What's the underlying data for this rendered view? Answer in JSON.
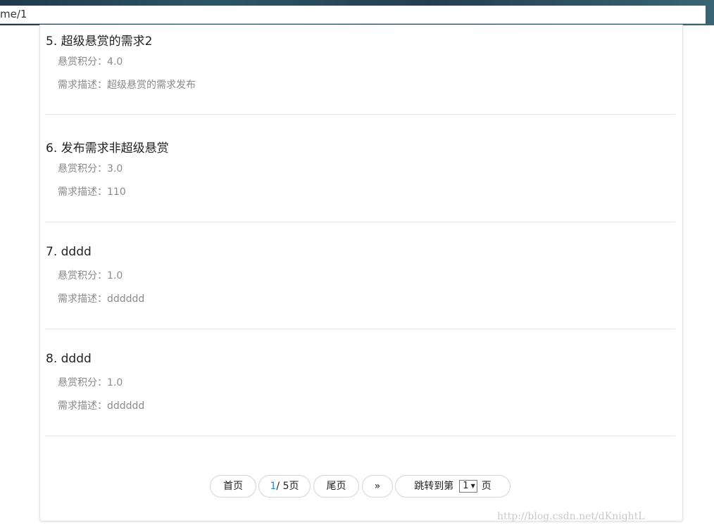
{
  "browser": {
    "url_fragment": "me/1"
  },
  "items": [
    {
      "title": "5. 超级悬赏的需求2",
      "points_label": "悬赏积分：",
      "points": "4.0",
      "desc_label": "需求描述：",
      "desc": "超级悬赏的需求发布"
    },
    {
      "title": "6. 发布需求非超级悬赏",
      "points_label": "悬赏积分：",
      "points": "3.0",
      "desc_label": "需求描述：",
      "desc": "110"
    },
    {
      "title": "7. dddd",
      "points_label": "悬赏积分：",
      "points": "1.0",
      "desc_label": "需求描述：",
      "desc": "dddddd"
    },
    {
      "title": "8. dddd",
      "points_label": "悬赏积分：",
      "points": "1.0",
      "desc_label": "需求描述：",
      "desc": "dddddd"
    }
  ],
  "pager": {
    "first": "首页",
    "current_page": "1",
    "total": "/ 5页",
    "last": "尾页",
    "next": "»",
    "jump_prefix": "跳转到第",
    "jump_value": "1",
    "jump_suffix": "页"
  },
  "watermark": "http://blog.csdn.net/dKnightL"
}
